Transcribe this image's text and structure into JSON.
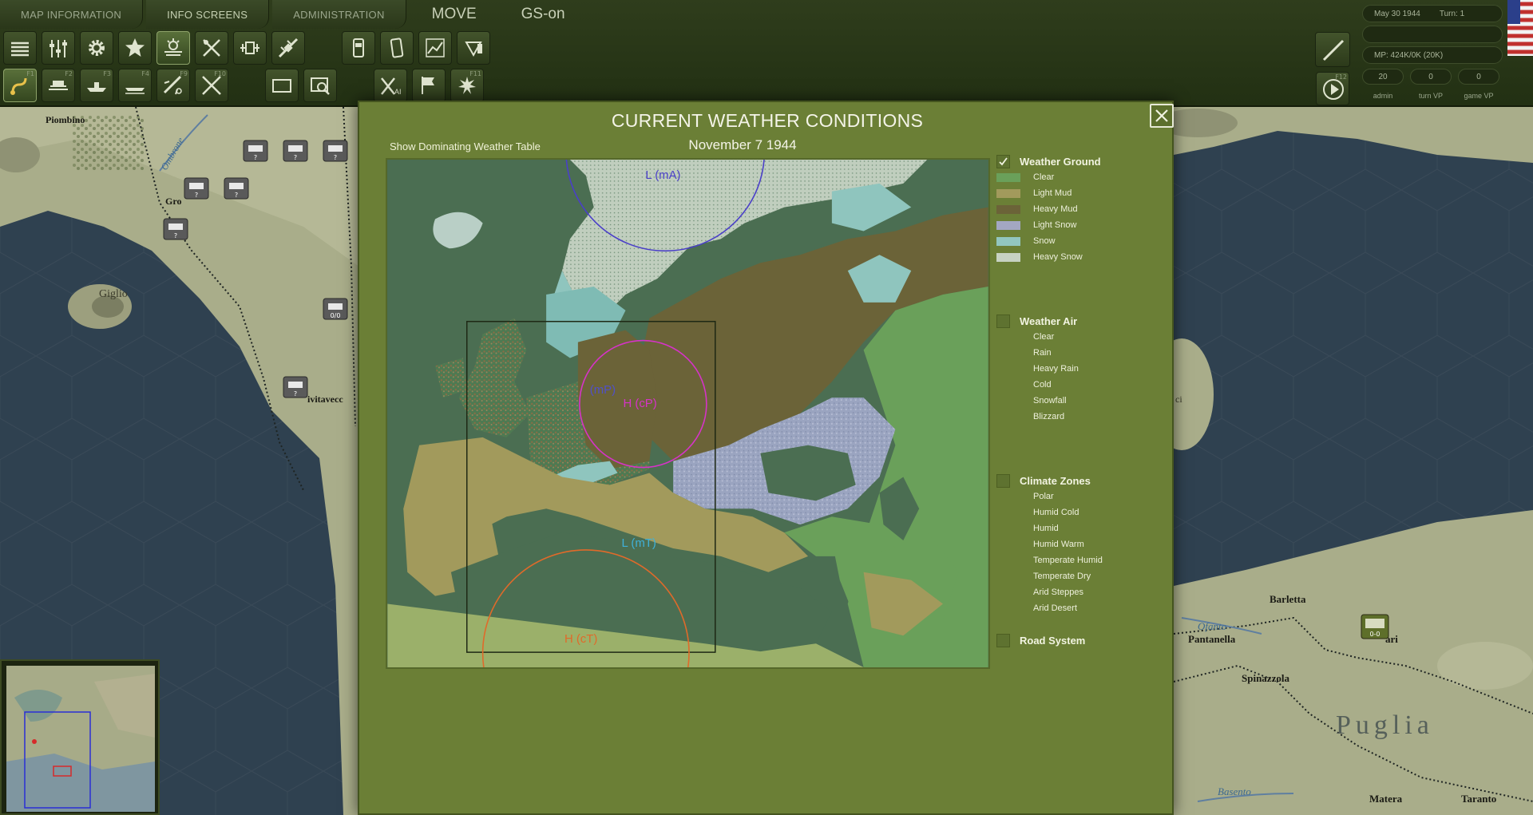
{
  "menu": {
    "tabs": [
      "MAP INFORMATION",
      "INFO SCREENS",
      "ADMINISTRATION"
    ],
    "move_label": "MOVE",
    "gs_label": "GS-on"
  },
  "toolbar": {
    "row1_icons": [
      "stack-layers-icon",
      "sliders-icon",
      "gear-icon",
      "star-icon",
      "weather-icon",
      "supply-icon",
      "vehicle-icon",
      "airdrop-icon",
      "card-icon",
      "card-tilt-icon",
      "chart-icon",
      "shield-icon"
    ],
    "row2": [
      {
        "icon": "move-path-icon",
        "fkey": "F1"
      },
      {
        "icon": "rail-icon",
        "fkey": "F2"
      },
      {
        "icon": "naval-icon",
        "fkey": "F3"
      },
      {
        "icon": "amphib-icon",
        "fkey": "F4"
      },
      {
        "icon": "air-strike-icon",
        "fkey": "F9"
      },
      {
        "icon": "air-recon-icon",
        "fkey": "F10"
      },
      {
        "icon": "rectangle-icon",
        "fkey": ""
      },
      {
        "icon": "select-zoom-icon",
        "fkey": ""
      },
      {
        "icon": "ai-icon",
        "fkey": ""
      },
      {
        "icon": "flag-icon",
        "fkey": ""
      },
      {
        "icon": "explosion-icon",
        "fkey": "F11"
      }
    ],
    "next_fkey": "F12"
  },
  "status": {
    "date": "May 30 1944",
    "turn": "Turn: 1",
    "mp": "MP: 424K/0K (20K)",
    "admin_value": "20",
    "turn_vp_value": "0",
    "game_vp_value": "0",
    "admin_label": "admin",
    "turn_vp_label": "turn VP",
    "game_vp_label": "game VP"
  },
  "map_labels": {
    "piombino": "Piombino",
    "ombrone": "Ombrone",
    "gro": "Gro",
    "giglio": "Giglio",
    "civitavecchia": "ivitavecc",
    "barletta": "Barletta",
    "ofanto": "Ofanto",
    "pantanella": "Pantanella",
    "spinazzola": "Spinazzola",
    "bari": "ari",
    "puglia": "Puglia",
    "basento": "Basento",
    "matera": "Matera",
    "taranto": "Taranto",
    "ci": "ci",
    "unit_question": "?",
    "unit_counter": "0/0",
    "bari_unit": "0-0"
  },
  "dialog": {
    "title": "CURRENT WEATHER CONDITIONS",
    "date": "November  7  1944",
    "show_table_link": "Show Dominating Weather Table",
    "fronts": [
      {
        "label": "L (mA)",
        "color": "#4a3fc8"
      },
      {
        "label": "(mP)",
        "color": "#5050c8"
      },
      {
        "label": "H (cP)",
        "color": "#d633c8"
      },
      {
        "label": "L (mT)",
        "color": "#3fb0d8"
      },
      {
        "label": "H (cT)",
        "color": "#e06a2a"
      }
    ]
  },
  "legend": {
    "weather_ground": {
      "title": "Weather Ground",
      "checked": true,
      "items": [
        {
          "label": "Clear",
          "color": "#6aa05a"
        },
        {
          "label": "Light Mud",
          "color": "#a29a5c"
        },
        {
          "label": "Heavy Mud",
          "color": "#6b6338"
        },
        {
          "label": "Light Snow",
          "color": "#a3a7c2"
        },
        {
          "label": "Snow",
          "color": "#92c6bf"
        },
        {
          "label": "Heavy Snow",
          "color": "#c7d2c2"
        }
      ]
    },
    "weather_air": {
      "title": "Weather Air",
      "checked": false,
      "items": [
        "Clear",
        "Rain",
        "Heavy Rain",
        "Cold",
        "Snowfall",
        "Blizzard"
      ]
    },
    "climate_zones": {
      "title": "Climate Zones",
      "checked": false,
      "items": [
        "Polar",
        "Humid Cold",
        "Humid",
        "Humid Warm",
        "Temperate Humid",
        "Temperate Dry",
        "Arid Steppes",
        "Arid Desert"
      ]
    },
    "road_system": {
      "title": "Road System",
      "checked": false
    }
  }
}
